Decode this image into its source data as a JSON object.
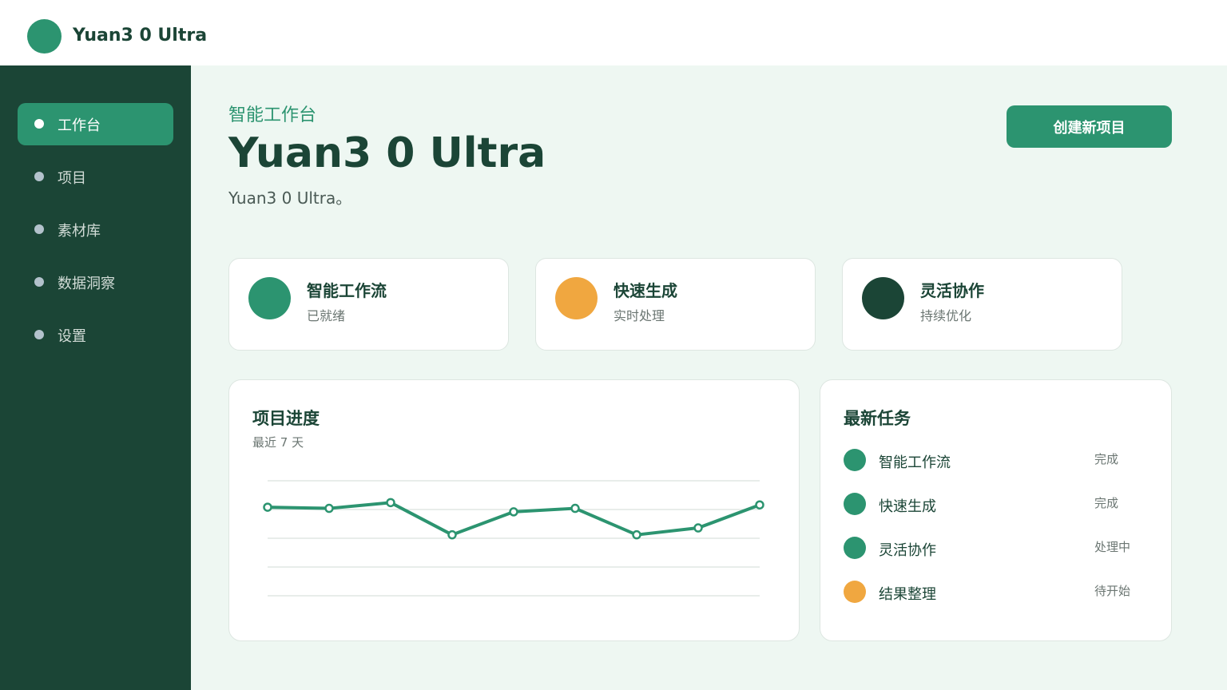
{
  "app": {
    "title": "Yuan3 0 Ultra"
  },
  "colors": {
    "primary": "#2c9470",
    "dark": "#1b4536",
    "accent": "#f0a740",
    "background": "#eef7f2"
  },
  "sidebar": {
    "items": [
      {
        "label": "工作台",
        "active": true
      },
      {
        "label": "项目",
        "active": false
      },
      {
        "label": "素材库",
        "active": false
      },
      {
        "label": "数据洞察",
        "active": false
      },
      {
        "label": "设置",
        "active": false
      }
    ]
  },
  "header": {
    "eyebrow": "智能工作台",
    "title": "Yuan3 0 Ultra",
    "subtitle": "Yuan3 0 Ultra。",
    "create_button": "创建新项目"
  },
  "stats": [
    {
      "title": "智能工作流",
      "subtitle": "已就绪",
      "color": "#2c9470"
    },
    {
      "title": "快速生成",
      "subtitle": "实时处理",
      "color": "#f0a740"
    },
    {
      "title": "灵活协作",
      "subtitle": "持续优化",
      "color": "#1b4536"
    }
  ],
  "progress": {
    "title": "项目进度",
    "subtitle": "最近 7 天"
  },
  "chart_data": {
    "type": "line",
    "title": "项目进度",
    "subtitle": "最近 7 天",
    "x": [
      1,
      2,
      3,
      4,
      5,
      6,
      7,
      8,
      9
    ],
    "series": [
      {
        "values": [
          77,
          76,
          81,
          53,
          73,
          76,
          53,
          59,
          79
        ],
        "color": "#2c9470"
      }
    ],
    "ylim": [
      0,
      100
    ],
    "grid": true,
    "legend": "none"
  },
  "tasks": {
    "title": "最新任务",
    "items": [
      {
        "name": "智能工作流",
        "status": "完成",
        "color": "#2c9470"
      },
      {
        "name": "快速生成",
        "status": "完成",
        "color": "#2c9470"
      },
      {
        "name": "灵活协作",
        "status": "处理中",
        "color": "#2c9470"
      },
      {
        "name": "结果整理",
        "status": "待开始",
        "color": "#f0a740"
      }
    ]
  }
}
